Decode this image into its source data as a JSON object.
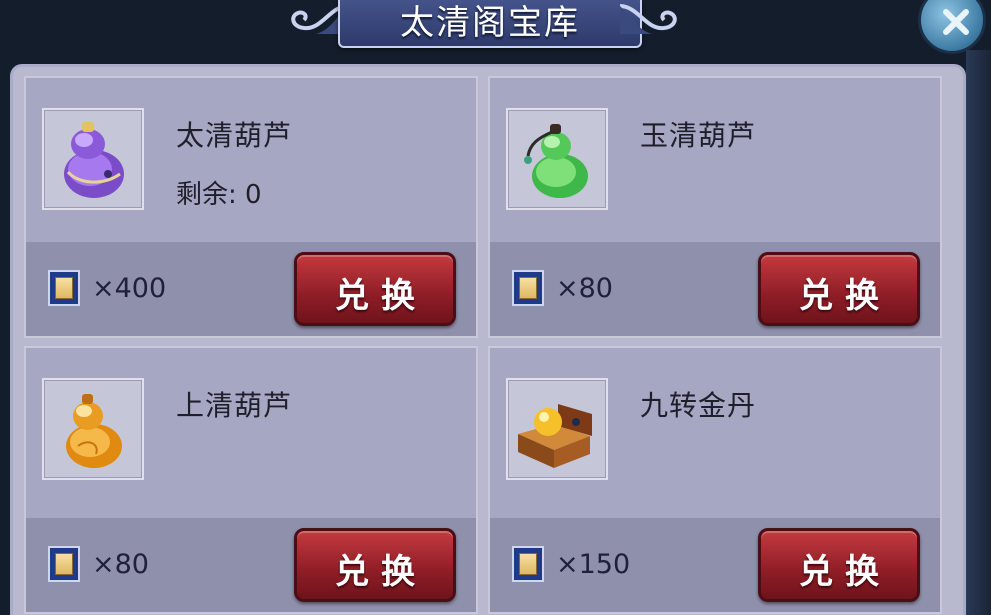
{
  "header": {
    "title": "太清阁宝库",
    "close_icon": "close-icon"
  },
  "colors": {
    "button_red": "#8e1d26",
    "panel": "#b8b9cf",
    "card_bottom": "#8f90ac"
  },
  "items": [
    {
      "name": "太清葫芦",
      "remaining": "剩余: 0",
      "icon": "purple-gourd-icon",
      "cost_icon": "scroll-token-icon",
      "cost": "×400",
      "button_label": "兑换"
    },
    {
      "name": "玉清葫芦",
      "icon": "green-gourd-icon",
      "cost_icon": "scroll-token-icon",
      "cost": "×80",
      "button_label": "兑换"
    },
    {
      "name": "上清葫芦",
      "icon": "orange-gourd-icon",
      "cost_icon": "scroll-token-icon",
      "cost": "×80",
      "button_label": "兑换"
    },
    {
      "name": "九转金丹",
      "icon": "golden-elixir-box-icon",
      "cost_icon": "scroll-token-icon",
      "cost": "×150",
      "button_label": "兑换"
    }
  ]
}
